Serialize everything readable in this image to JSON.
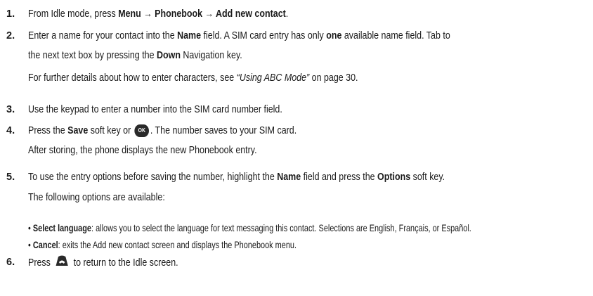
{
  "steps": [
    {
      "num": "1.",
      "t1": "From Idle mode, press ",
      "b1": "Menu",
      "t2": " → ",
      "b2": "Phonebook",
      "t3": " → ",
      "b3": "Add new contact",
      "t4": "."
    },
    {
      "num": "2.",
      "t1": "Enter a name for your contact into the ",
      "b1": "Name",
      "t2": " field. A SIM card entry has only ",
      "b2": "one",
      "t3": " available name field. Tab to",
      "l2a": "the next text box by pressing the ",
      "l2b": "Down",
      "l2c": " Navigation key.",
      "l3a": "For further details about how to enter characters, see ",
      "l3i": "“Using ABC Mode”",
      "l3b": " on page 30."
    },
    {
      "num": "3.",
      "t1": "Use the keypad to enter a number into the SIM card number field."
    },
    {
      "num": "4.",
      "t1": "Press the ",
      "b1": "Save",
      "t2": " soft key or ",
      "key": "OK",
      "t3": ". The number saves to your SIM card.",
      "l2": "After storing, the phone displays the new Phonebook entry."
    },
    {
      "num": "5.",
      "t1": "To use the entry options before saving the number, highlight the ",
      "b1": "Name",
      "t2": " field and press the ",
      "b2": "Options",
      "t3": " soft key.",
      "l2": "The following options are available:"
    },
    {
      "num": "6.",
      "t1": "Press ",
      "icon": "end-key-icon",
      "t2": " to return to the Idle screen."
    }
  ],
  "bullets": [
    {
      "b": "Select language",
      "t": ": allows you to select the language for text messaging this contact. Selections are English, Français, or Español."
    },
    {
      "b": "Cancel",
      "t": ": exits the Add new contact screen and displays the Phonebook menu."
    }
  ],
  "bullet_char": "•"
}
